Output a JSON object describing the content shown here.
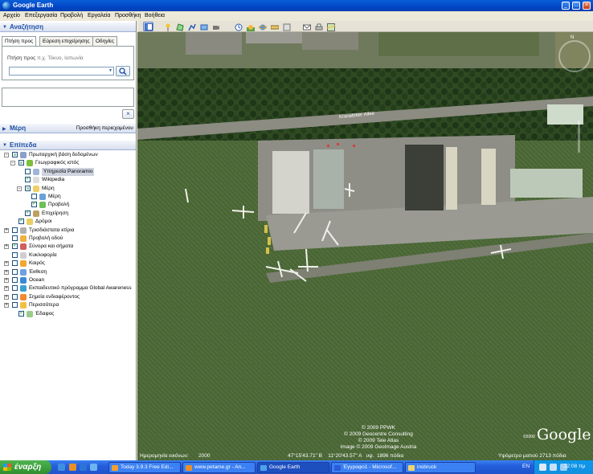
{
  "window": {
    "title": "Google Earth"
  },
  "menu": [
    "Αρχείο",
    "Επεξεργασία",
    "Προβολή",
    "Εργαλεία",
    "Προσθήκη",
    "Βοήθεια"
  ],
  "search": {
    "header": "Αναζήτηση",
    "tabs": [
      "Πτήση προς",
      "Εύρεση επιχείρησης",
      "Οδηγίες"
    ],
    "hint_label": "Πτήση προς",
    "hint_example": "π.χ. Τόκυο, Ιαπωνία",
    "input_value": ""
  },
  "places": {
    "header": "Μέρη",
    "add_content": "Προσθήκη περιεχομένου"
  },
  "layers": {
    "header": "Επίπεδα",
    "items": [
      {
        "label": "Πρωταρχική βάση δεδομένων",
        "checked": "partial",
        "expand": "-",
        "icon": "db-icon"
      },
      {
        "label": "Γεωγραφικός ιστός",
        "checked": "partial",
        "expand": "-",
        "icon": "star-icon"
      },
      {
        "label": "Υπηρεσία Panoramio",
        "checked": "off",
        "expand": "",
        "icon": "photo-icon"
      },
      {
        "label": "Wikipedia",
        "checked": "on",
        "expand": "",
        "icon": "wiki-icon"
      },
      {
        "label": "Μέρη",
        "checked": "partial",
        "expand": "-",
        "icon": "folder-icon"
      },
      {
        "label": "Μέρη",
        "checked": "off",
        "expand": "",
        "icon": "places-icon"
      },
      {
        "label": "Προβολή",
        "checked": "on",
        "expand": "",
        "icon": "view-icon"
      },
      {
        "label": "Επιχείρηση",
        "checked": "on",
        "expand": "",
        "icon": "business-icon"
      },
      {
        "label": "Δρόμοι",
        "checked": "on",
        "expand": "",
        "icon": "roads-icon"
      },
      {
        "label": "Τρισδιάστατα κτίρια",
        "checked": "off",
        "expand": "+",
        "icon": "buildings-icon"
      },
      {
        "label": "Προβολή οδού",
        "checked": "off",
        "expand": "",
        "icon": "streetview-icon"
      },
      {
        "label": "Σύνορα και σήματα",
        "checked": "on",
        "expand": "+",
        "icon": "borders-icon"
      },
      {
        "label": "Κυκλοφορία",
        "checked": "off",
        "expand": "",
        "icon": "traffic-icon"
      },
      {
        "label": "Καιρός",
        "checked": "off",
        "expand": "+",
        "icon": "weather-icon"
      },
      {
        "label": "Έκθεση",
        "checked": "off",
        "expand": "+",
        "icon": "gallery-icon"
      },
      {
        "label": "Ocean",
        "checked": "off",
        "expand": "+",
        "icon": "ocean-icon"
      },
      {
        "label": "Εκπαιδευτικό πρόγραμμα Global Awareness",
        "checked": "off",
        "expand": "+",
        "icon": "globe-icon"
      },
      {
        "label": "Σημεία ενδιαφέροντος",
        "checked": "off",
        "expand": "+",
        "icon": "poi-icon"
      },
      {
        "label": "Περισσότερα",
        "checked": "off",
        "expand": "+",
        "icon": "more-icon"
      },
      {
        "label": "Έδαφος",
        "checked": "on",
        "expand": "",
        "icon": "terrain-icon"
      }
    ]
  },
  "map": {
    "street_label": "Kranebitter Allee",
    "copyright": [
      "© 2009 PPWK",
      "© 2009 Geocentre Consulting",
      "© 2009 Tele Atlas",
      "Image © 2009 GeoImage Austria"
    ],
    "imagery_date_label": "Ημερομηνία εικόνων:",
    "imagery_date": "2000",
    "coordinates": "47°15'43.71\" Β    11°20'43.57\" Α   υψ.  1896 πόδια",
    "eye_altitude": "Υψόμετρο ματιού   2713 πόδια",
    "logo": "Google",
    "logo_year": "©2009",
    "compass_north": "N"
  },
  "taskbar": {
    "start": "έναρξη",
    "tasks": [
      "Today 3.9.3 Free Edi...",
      "www.petame.gr - An...",
      "Google Earth",
      "Έγγραφο1 - Microsof...",
      "insbruck"
    ],
    "language": "EN",
    "clock": "12:08 πμ"
  }
}
